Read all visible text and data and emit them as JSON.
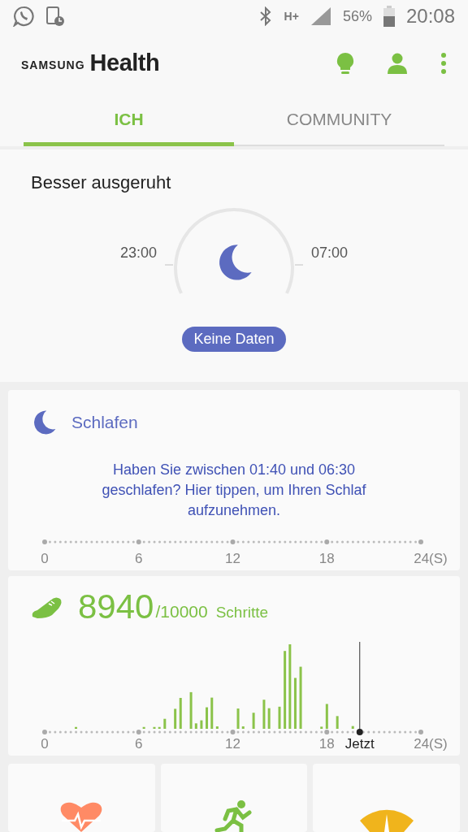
{
  "status_bar": {
    "network": "H+",
    "battery_text": "56%",
    "time": "20:08"
  },
  "header": {
    "brand": "SAMSUNG",
    "product": "Health"
  },
  "tabs": [
    {
      "label": "ICH",
      "selected": true
    },
    {
      "label": "COMMUNITY",
      "selected": false
    }
  ],
  "sleep_summary": {
    "title": "Besser ausgeruht",
    "bedtime": "23:00",
    "wake_time": "07:00",
    "badge": "Keine Daten"
  },
  "sleep_card": {
    "title": "Schlafen",
    "message": "Haben Sie zwischen 01:40 und 06:30 geschlafen? Hier tippen, um Ihren Schlaf aufzunehmen.",
    "axis_labels": [
      "0",
      "6",
      "12",
      "18",
      "24(S)"
    ]
  },
  "steps_card": {
    "count": "8940",
    "goal": "/10000",
    "unit": "Schritte",
    "axis_labels": [
      "0",
      "6",
      "12",
      "18",
      "24(S)"
    ],
    "now_label": "Jetzt"
  },
  "tiles": [
    {
      "kind": "heart"
    },
    {
      "kind": "runner"
    },
    {
      "kind": "gauge"
    }
  ]
}
